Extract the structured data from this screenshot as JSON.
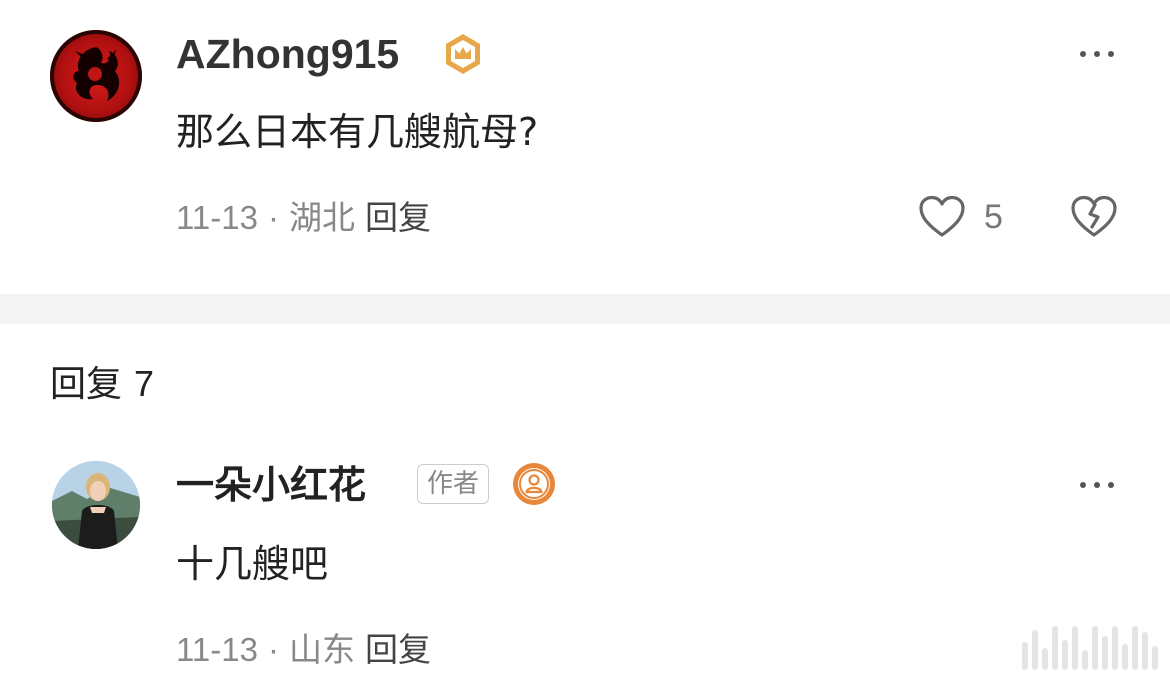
{
  "main_comment": {
    "username": "AZhong915",
    "text": "那么日本有几艘航母?",
    "date": "11-13",
    "separator": "·",
    "location": "湖北",
    "reply_label": "回复",
    "like_count": "5",
    "avatar_icon": "dragon-emblem-icon",
    "badge_icon": "crown-badge-icon",
    "accent_color": "#e0a040"
  },
  "replies_section": {
    "title": "回复",
    "count": "7"
  },
  "reply_comment": {
    "username": "一朵小红花",
    "author_tag": "作者",
    "text": "十几艘吧",
    "date": "11-13",
    "separator": "·",
    "location": "山东",
    "reply_label": "回复",
    "badge_icon": "person-badge-icon",
    "badge_color": "#e8873a"
  }
}
